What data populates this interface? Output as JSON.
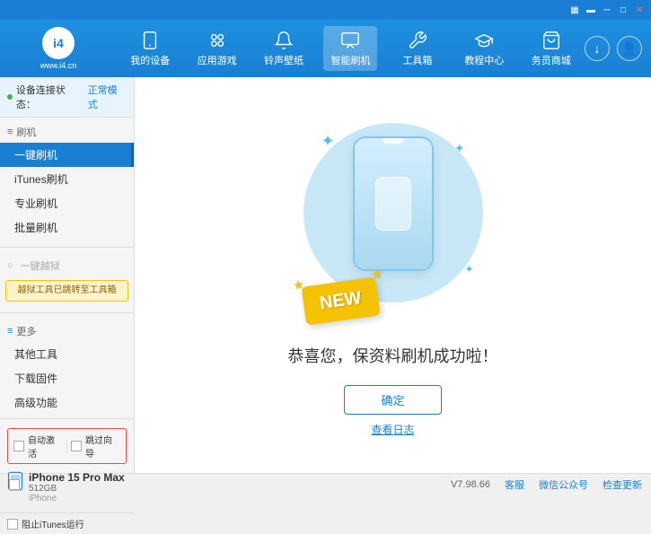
{
  "topbar": {
    "icons": [
      "wifi",
      "battery",
      "minimize",
      "maximize",
      "close"
    ]
  },
  "header": {
    "logo": "i4",
    "logo_sub": "www.i4.cn",
    "nav": [
      {
        "id": "my-device",
        "label": "我的设备",
        "icon": "phone"
      },
      {
        "id": "apps",
        "label": "应用游戏",
        "icon": "app"
      },
      {
        "id": "ringtone",
        "label": "铃声壁纸",
        "icon": "ring"
      },
      {
        "id": "smart-flash",
        "label": "智能刷机",
        "icon": "smart",
        "active": true
      },
      {
        "id": "toolbox",
        "label": "工具箱",
        "icon": "tool"
      },
      {
        "id": "tutorial",
        "label": "教程中心",
        "icon": "tutorial"
      },
      {
        "id": "service",
        "label": "务员商城",
        "icon": "shop"
      }
    ]
  },
  "sidebar": {
    "status_label": "设备连接状态：",
    "status_mode": "正常模式",
    "sections": [
      {
        "header": "刷机",
        "items": [
          {
            "label": "一键刷机",
            "active": true
          },
          {
            "label": "iTunes刷机"
          },
          {
            "label": "专业刷机"
          },
          {
            "label": "批量刷机"
          }
        ]
      },
      {
        "header": "一键越狱",
        "disabled": true,
        "warning": "越狱工具已跳转至工具箱"
      },
      {
        "header": "更多",
        "items": [
          {
            "label": "其他工具"
          },
          {
            "label": "下载固件"
          },
          {
            "label": "高级功能"
          }
        ]
      }
    ],
    "auto_activate_label": "自动激活",
    "guide_activate_label": "跳过向导",
    "device": {
      "name": "iPhone 15 Pro Max",
      "storage": "512GB",
      "type": "iPhone"
    },
    "itunes_label": "阻止iTunes运行"
  },
  "content": {
    "new_badge": "NEW",
    "success_message": "恭喜您，保资料刷机成功啦！",
    "confirm_button": "确定",
    "log_link": "查看日志"
  },
  "footer": {
    "version": "V7.98.66",
    "items": [
      "客服",
      "微信公众号",
      "检查更新"
    ]
  }
}
